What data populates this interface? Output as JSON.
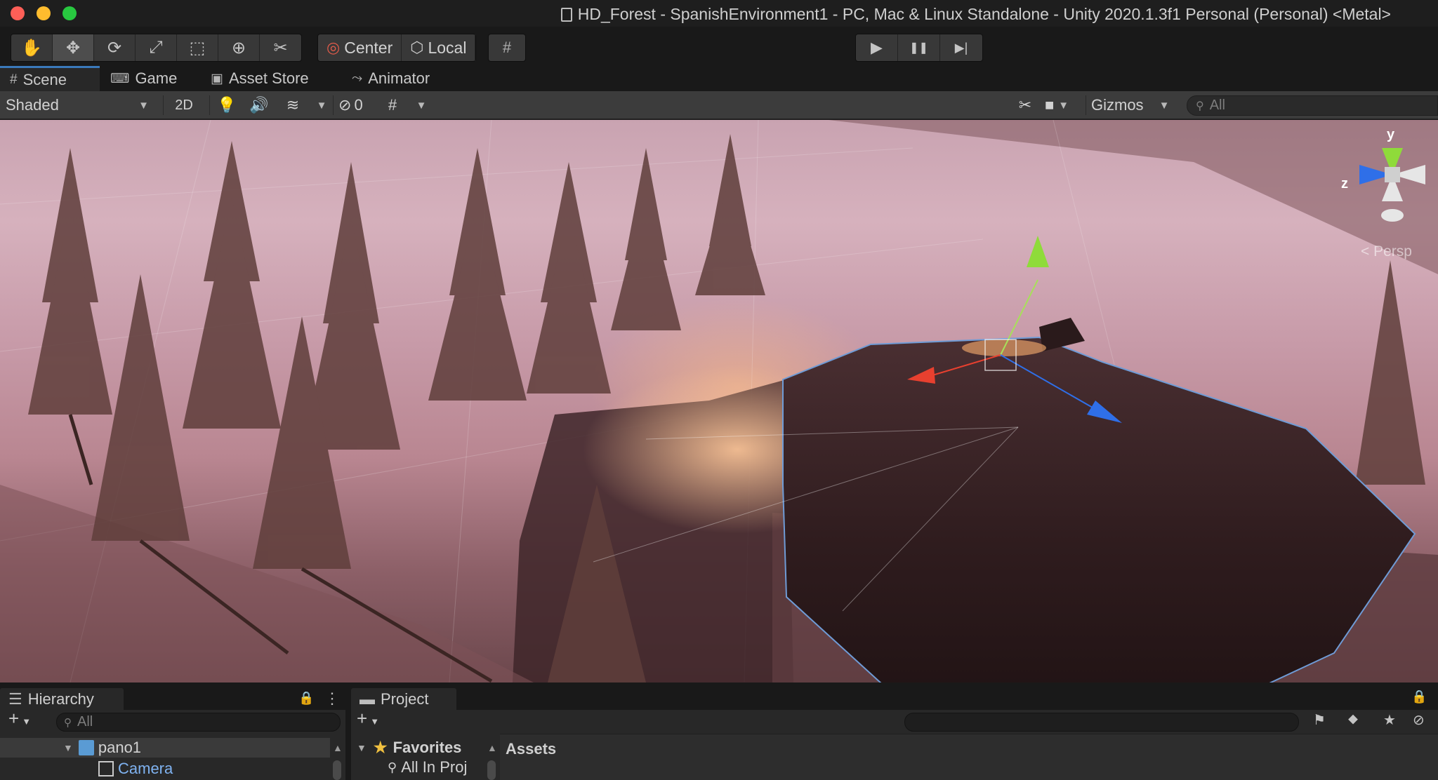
{
  "window": {
    "title": "HD_Forest - SpanishEnvironment1 - PC, Mac & Linux Standalone - Unity 2020.1.3f1 Personal (Personal) <Metal>"
  },
  "toolbar": {
    "tools": [
      {
        "name": "hand-tool",
        "icon": "✋"
      },
      {
        "name": "move-tool",
        "icon": "✥"
      },
      {
        "name": "rotate-tool",
        "icon": "⟳"
      },
      {
        "name": "scale-tool",
        "icon": "⤢"
      },
      {
        "name": "rect-tool",
        "icon": "⬚"
      },
      {
        "name": "transform-tool",
        "icon": "⊕"
      },
      {
        "name": "custom-tool",
        "icon": "✂"
      }
    ],
    "pivot_label": "Center",
    "rotation_label": "Local",
    "play_icon": "▶",
    "pause_icon": "❚❚",
    "step_icon": "▶|"
  },
  "tabs": [
    {
      "label": "Scene",
      "icon": "#"
    },
    {
      "label": "Game",
      "icon": "🎮"
    },
    {
      "label": "Asset Store",
      "icon": "🛍"
    },
    {
      "label": "Animator",
      "icon": "⤳"
    }
  ],
  "scene_toolbar": {
    "draw_mode": "Shaded",
    "mode_2d": "2D",
    "hidden_count": "0",
    "gizmos_label": "Gizmos",
    "search_placeholder": "All"
  },
  "viewport": {
    "projection_label": "< Persp",
    "axis_y": "y",
    "axis_z": "z"
  },
  "hierarchy": {
    "tab_label": "Hierarchy",
    "search_placeholder": "All",
    "items": [
      {
        "label": "pano1"
      },
      {
        "label": "Camera"
      }
    ]
  },
  "project": {
    "tab_label": "Project",
    "favorites_label": "Favorites",
    "favorites_item": "All In Proj",
    "assets_label": "Assets"
  },
  "colors": {
    "accent": "#3a79bb",
    "close": "#fe5f57",
    "minimize": "#febc2e",
    "maximize": "#28c840",
    "gizmo_x": "#e8402f",
    "gizmo_y": "#8fdb3a",
    "gizmo_z": "#2f6fe8"
  }
}
